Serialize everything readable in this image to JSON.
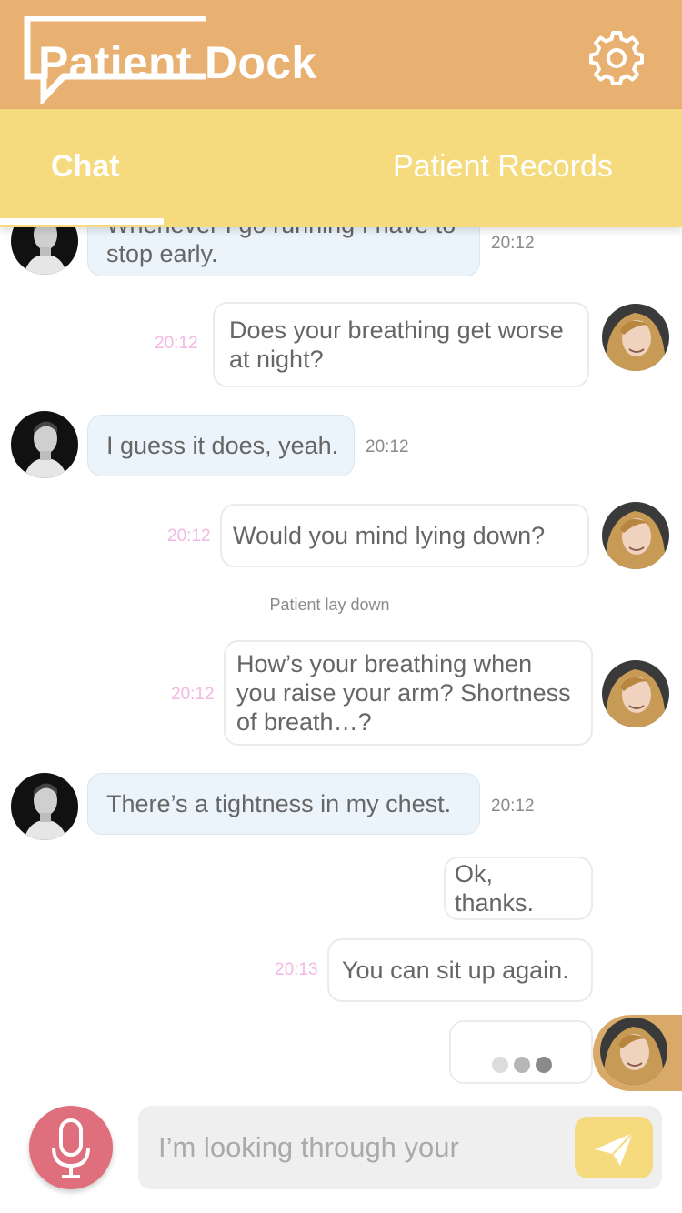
{
  "app": {
    "title": "Patient Dock",
    "settings_icon": "gear-icon"
  },
  "tabs": [
    {
      "label": "Chat",
      "active": true
    },
    {
      "label": "Patient Records",
      "active": false
    }
  ],
  "messages": [
    {
      "from": "patient",
      "text": "Whenever I go running I have to",
      "text2": "stop early.",
      "time": "20:12"
    },
    {
      "from": "doctor",
      "text": "Does your breathing get worse",
      "text2": "at night?",
      "time": "20:12"
    },
    {
      "from": "patient",
      "text": "I guess it does, yeah.",
      "time": "20:12"
    },
    {
      "from": "doctor",
      "text": "Would you mind lying down?",
      "time": "20:12"
    },
    {
      "from": "system",
      "text": "Patient lay down"
    },
    {
      "from": "doctor",
      "text": "How’s your breathing when",
      "text2": "you raise your arm? Shortness",
      "text3": "of breath…?",
      "time": "20:12"
    },
    {
      "from": "patient",
      "text": "There’s a tightness in my chest.",
      "time": "20:12"
    },
    {
      "from": "doctor",
      "text": "Ok, thanks."
    },
    {
      "from": "doctor",
      "text": "You can sit up again.",
      "time": "20:13"
    },
    {
      "from": "doctor",
      "typing": true,
      "text": "●●●"
    }
  ],
  "composer": {
    "value": "I’m looking through your",
    "mic_icon": "microphone-icon",
    "send_icon": "send-icon"
  },
  "colors": {
    "header": "#E9B171",
    "tabs": "#F5DB7E",
    "patient_bubble": "#EBF4FB",
    "doctor_time": "#F2B8E4",
    "mic": "#DF6F7C"
  }
}
